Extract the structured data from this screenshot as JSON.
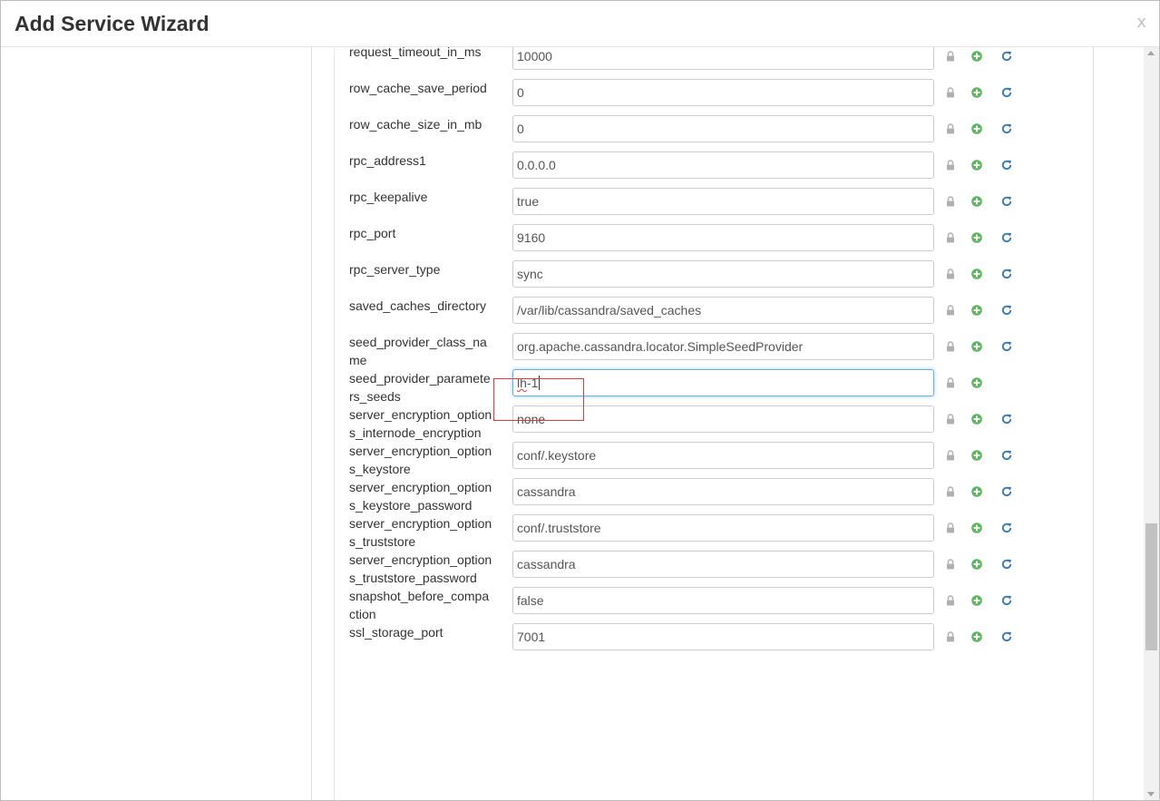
{
  "dialog": {
    "title": "Add Service Wizard",
    "close_label": "x"
  },
  "colors": {
    "lock": "#b0b0b0",
    "plus": "#5cb85c",
    "refresh": "#337ab7",
    "highlight": "#e03a3a"
  },
  "icons": {
    "lock": "lock-icon",
    "add": "plus-circle-icon",
    "reset": "refresh-icon"
  },
  "properties": [
    {
      "name": "request_timeout_in_ms",
      "value": "10000",
      "reset": true
    },
    {
      "name": "row_cache_save_period",
      "value": "0",
      "reset": true
    },
    {
      "name": "row_cache_size_in_mb",
      "value": "0",
      "reset": true
    },
    {
      "name": "rpc_address1",
      "value": "0.0.0.0",
      "reset": true
    },
    {
      "name": "rpc_keepalive",
      "value": "true",
      "reset": true
    },
    {
      "name": "rpc_port",
      "value": "9160",
      "reset": true
    },
    {
      "name": "rpc_server_type",
      "value": "sync",
      "reset": true
    },
    {
      "name": "saved_caches_directory",
      "value": "/var/lib/cassandra/saved_caches",
      "reset": true
    },
    {
      "name": "seed_provider_class_name",
      "value": "org.apache.cassandra.locator.SimpleSeedProvider",
      "reset": true
    },
    {
      "name": "seed_provider_parameters_seeds",
      "value": "lh-1",
      "reset": false,
      "focused": true
    },
    {
      "name": "server_encryption_options_internode_encryption",
      "value": "none",
      "reset": true
    },
    {
      "name": "server_encryption_options_keystore",
      "value": "conf/.keystore",
      "reset": true
    },
    {
      "name": "server_encryption_options_keystore_password",
      "value": "cassandra",
      "reset": true
    },
    {
      "name": "server_encryption_options_truststore",
      "value": "conf/.truststore",
      "reset": true
    },
    {
      "name": "server_encryption_options_truststore_password",
      "value": "cassandra",
      "reset": true
    },
    {
      "name": "snapshot_before_compaction",
      "value": "false",
      "reset": true
    },
    {
      "name": "ssl_storage_port",
      "value": "7001",
      "reset": true
    }
  ]
}
